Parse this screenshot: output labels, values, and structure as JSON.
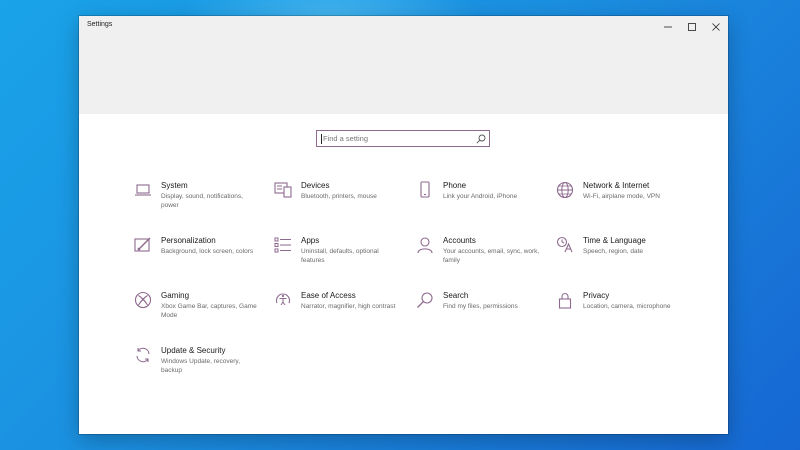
{
  "window": {
    "title": "Settings",
    "controls": [
      "minimize",
      "maximize",
      "close"
    ]
  },
  "search": {
    "placeholder": "Find a setting",
    "icon": "search-icon"
  },
  "accent_color": "#8e6a8e",
  "categories": [
    {
      "title": "System",
      "desc": "Display, sound, notifications, power",
      "icon": "laptop-icon"
    },
    {
      "title": "Devices",
      "desc": "Bluetooth, printers, mouse",
      "icon": "devices-icon"
    },
    {
      "title": "Phone",
      "desc": "Link your Android, iPhone",
      "icon": "phone-icon"
    },
    {
      "title": "Network & Internet",
      "desc": "Wi-Fi, airplane mode, VPN",
      "icon": "globe-icon"
    },
    {
      "title": "Personalization",
      "desc": "Background, lock screen, colors",
      "icon": "paint-icon"
    },
    {
      "title": "Apps",
      "desc": "Uninstall, defaults, optional features",
      "icon": "apps-list-icon"
    },
    {
      "title": "Accounts",
      "desc": "Your accounts, email, sync, work, family",
      "icon": "person-icon"
    },
    {
      "title": "Time & Language",
      "desc": "Speech, region, date",
      "icon": "time-language-icon"
    },
    {
      "title": "Gaming",
      "desc": "Xbox Game Bar, captures, Game Mode",
      "icon": "xbox-icon"
    },
    {
      "title": "Ease of Access",
      "desc": "Narrator, magnifier, high contrast",
      "icon": "ease-of-access-icon"
    },
    {
      "title": "Search",
      "desc": "Find my files, permissions",
      "icon": "search-category-icon"
    },
    {
      "title": "Privacy",
      "desc": "Location, camera, microphone",
      "icon": "lock-icon"
    },
    {
      "title": "Update & Security",
      "desc": "Windows Update, recovery, backup",
      "icon": "sync-icon"
    }
  ]
}
